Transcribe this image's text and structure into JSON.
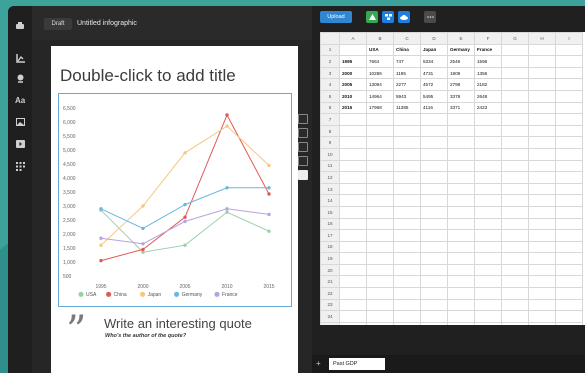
{
  "topbar": {
    "draft_label": "Draft",
    "doc_title": "Untitled infographic"
  },
  "sidebar": {
    "items": [
      "chart-icon",
      "map-pin-icon",
      "text-icon",
      "image-icon",
      "video-icon",
      "grid-icon"
    ]
  },
  "infographic": {
    "title": "Double-click to add title",
    "quote_mark": "”",
    "quote_text": "Write an interesting quote",
    "quote_author": "Who's the author of the quote?"
  },
  "chart_data": {
    "type": "line",
    "title": "",
    "xlabel": "",
    "ylabel": "",
    "x": [
      "1995",
      "2000",
      "2005",
      "2010",
      "2015"
    ],
    "y_ticks": [
      "500",
      "1,000",
      "1,500",
      "2,000",
      "2,500",
      "3,000",
      "3,500",
      "4,000",
      "4,500",
      "5,000",
      "5,500",
      "6,000",
      "6,500"
    ],
    "ylim": [
      500,
      6500
    ],
    "grid": false,
    "legend_position": "bottom",
    "series": [
      {
        "name": "USA",
        "color": "#9ad0a9",
        "values": [
          2850,
          1350,
          1600,
          2780,
          2100
        ]
      },
      {
        "name": "China",
        "color": "#e05a55",
        "values": [
          1050,
          1450,
          2600,
          6250,
          3430
        ]
      },
      {
        "name": "Japan",
        "color": "#f7c77c",
        "values": [
          1600,
          3000,
          4900,
          5850,
          4450
        ]
      },
      {
        "name": "Germany",
        "color": "#6bb7e0",
        "values": [
          2900,
          2200,
          3050,
          3650,
          3650
        ]
      },
      {
        "name": "France",
        "color": "#b9a3dc",
        "values": [
          1850,
          1650,
          2450,
          2900,
          2700
        ]
      }
    ]
  },
  "spreadsheet": {
    "toolbar": {
      "upload_label": "Upload"
    },
    "columns": [
      "",
      "A",
      "B",
      "C",
      "D",
      "E",
      "F",
      "G",
      "H",
      "I"
    ],
    "rows": [
      [
        "",
        "USA",
        "China",
        "Japan",
        "Germany",
        "France"
      ],
      [
        "1995",
        "7664",
        "747",
        "5334",
        "2546",
        "1596"
      ],
      [
        "2000",
        "10286",
        "1195",
        "4731",
        "1909",
        "1356"
      ],
      [
        "2005",
        "13094",
        "2277",
        "4572",
        "2798",
        "2182"
      ],
      [
        "2010",
        "14964",
        "5943",
        "5495",
        "3378",
        "2648"
      ],
      [
        "2015",
        "17968",
        "11385",
        "4116",
        "3371",
        "2423"
      ]
    ],
    "row_count": 26,
    "sheet_tab": "Past GDP",
    "add_tab": "+"
  }
}
